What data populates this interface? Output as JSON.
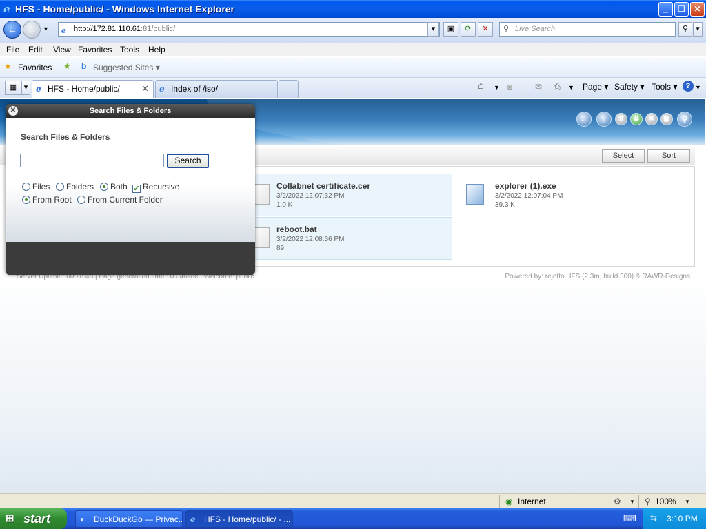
{
  "window": {
    "title": "HFS - Home/public/ - Windows Internet Explorer",
    "btn_min": "_",
    "btn_max": "❐",
    "btn_close": "✕"
  },
  "address": {
    "url_main": "http://172.81.110.61",
    "url_rest": ":81/public/",
    "search_placeholder": "Live Search"
  },
  "menu": [
    "File",
    "Edit",
    "View",
    "Favorites",
    "Tools",
    "Help"
  ],
  "favorites": {
    "label": "Favorites",
    "suggested": "Suggested Sites ▾"
  },
  "tabs": [
    {
      "label": "HFS - Home/public/"
    },
    {
      "label": "Index of /iso/"
    }
  ],
  "command_bar": {
    "page": "Page ▾",
    "safety": "Safety ▾",
    "tools": "Tools ▾",
    "help": "?"
  },
  "hfs": {
    "toolbar": {
      "select": "Select",
      "sort": "Sort"
    },
    "files": [
      {
        "name": "Collabnet certificate.cer",
        "date": "3/2/2022 12:07:32 PM",
        "size": "1.0 K",
        "icon": "certificate-file-icon"
      },
      {
        "name": "explorer (1).exe",
        "date": "3/2/2022 12:07:04 PM",
        "size": "39.3 K",
        "icon": "exe-file-icon"
      },
      {
        "name": "reboot.bat",
        "date": "3/2/2022 12:08:36 PM",
        "size": "89",
        "icon": "bat-file-icon"
      }
    ],
    "footer_left": "Server Uptime : 00:28:48  |  Page generation time : 0.046sec  |  Welcome: public",
    "footer_right": "Powered by: rejetto HFS (2.3m, build 300) & RAWR-Designs"
  },
  "modal": {
    "header": "Search Files & Folders",
    "heading": "Search Files & Folders",
    "input_value": "",
    "search_button": "Search",
    "options": {
      "files": "Files",
      "folders": "Folders",
      "both": "Both",
      "recursive": "Recursive",
      "from_root": "From Root",
      "from_current": "From Current Folder"
    },
    "selected": {
      "type": "Both",
      "recursive": true,
      "scope": "From Root"
    }
  },
  "status": {
    "zone": "Internet",
    "zoom": "100%"
  },
  "taskbar": {
    "start": "start",
    "items": [
      {
        "label": "DuckDuckGo — Privac..."
      },
      {
        "label": "HFS - Home/public/ - ..."
      }
    ],
    "clock": "3:10 PM"
  }
}
